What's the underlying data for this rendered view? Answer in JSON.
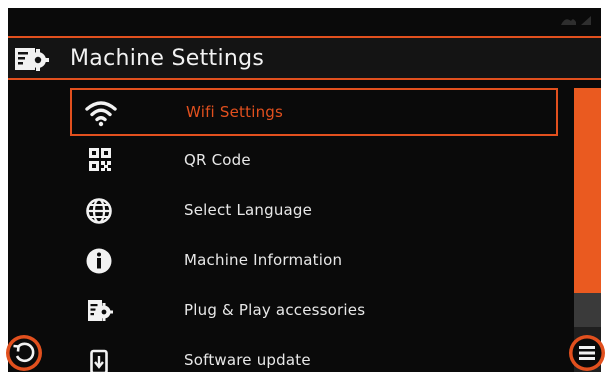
{
  "header": {
    "title": "Machine Settings",
    "icon": "machine-settings-icon"
  },
  "menu": {
    "items": [
      {
        "label": "Wifi Settings",
        "icon": "wifi-icon",
        "selected": true
      },
      {
        "label": "QR Code",
        "icon": "qr-code-icon",
        "selected": false
      },
      {
        "label": "Select Language",
        "icon": "globe-icon",
        "selected": false
      },
      {
        "label": "Machine Information",
        "icon": "info-icon",
        "selected": false
      },
      {
        "label": "Plug & Play accessories",
        "icon": "accessories-icon",
        "selected": false
      },
      {
        "label": "Software update",
        "icon": "software-update-icon",
        "selected": false
      }
    ]
  },
  "footer": {
    "back_icon": "back-icon",
    "menu_icon": "menu-icon"
  },
  "colors": {
    "accent": "#e2501e",
    "background": "#0a0a0a",
    "text": "#e8e8e8"
  }
}
